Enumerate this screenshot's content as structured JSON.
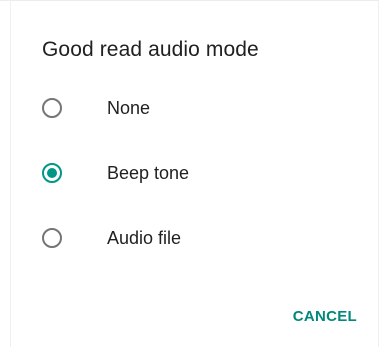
{
  "dialog": {
    "title": "Good read audio mode",
    "options": [
      {
        "label": "None",
        "selected": false
      },
      {
        "label": "Beep tone",
        "selected": true
      },
      {
        "label": "Audio file",
        "selected": false
      }
    ],
    "cancel_label": "CANCEL"
  },
  "colors": {
    "accent": "#009688",
    "radio_unselected": "#757575",
    "text": "#212121"
  },
  "icons": {
    "unselected": "radio-unchecked-icon",
    "selected": "radio-checked-icon"
  }
}
